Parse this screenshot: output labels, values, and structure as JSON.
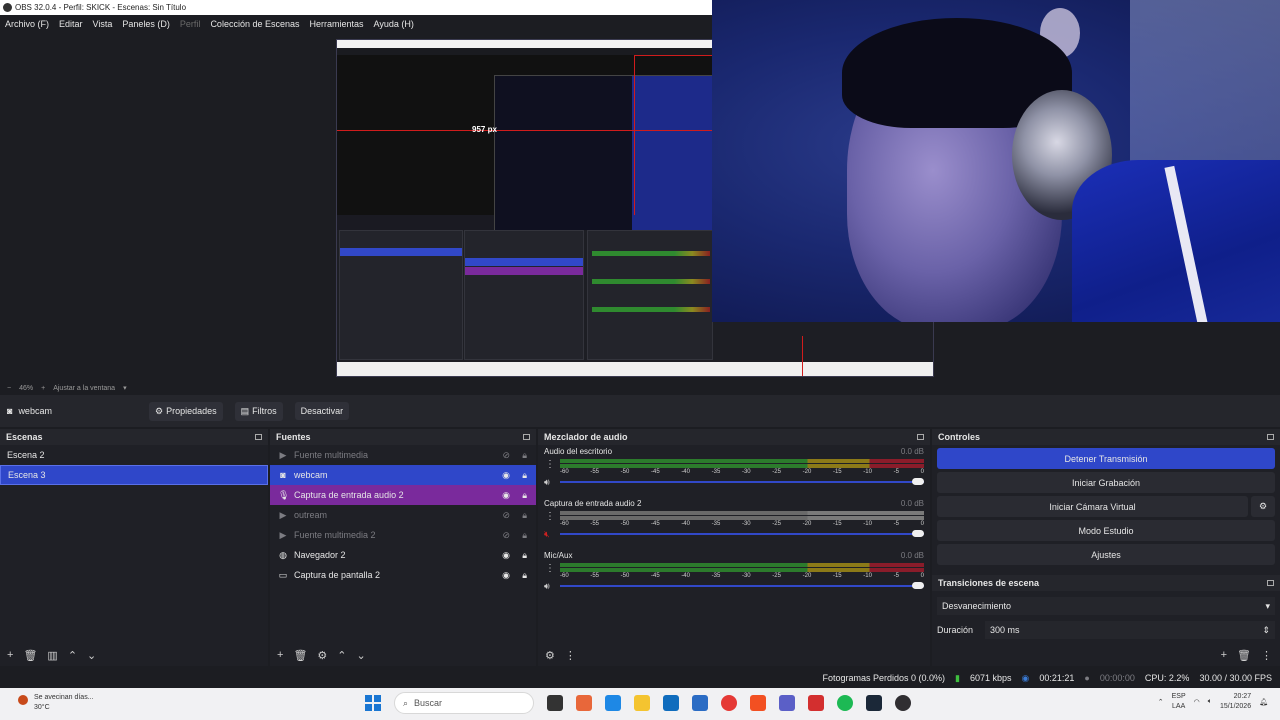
{
  "window": {
    "title": "OBS 32.0.4 - Perfil: SKICK - Escenas: Sin Título"
  },
  "menu": [
    {
      "label": "Archivo (F)",
      "enabled": true
    },
    {
      "label": "Editar",
      "enabled": true
    },
    {
      "label": "Vista",
      "enabled": true
    },
    {
      "label": "Paneles (D)",
      "enabled": true
    },
    {
      "label": "Perfil",
      "enabled": false
    },
    {
      "label": "Colección de Escenas",
      "enabled": true
    },
    {
      "label": "Herramientas",
      "enabled": true
    },
    {
      "label": "Ayuda (H)",
      "enabled": true
    }
  ],
  "preview": {
    "measure_label": "957 px"
  },
  "zoom": {
    "minus": "−",
    "level": "46%",
    "plus": "+",
    "fit_label": "Ajustar a la ventana"
  },
  "context": {
    "source_name": "webcam",
    "properties_label": "Propiedades",
    "filters_label": "Filtros",
    "deactivate_label": "Desactivar"
  },
  "scenes": {
    "title": "Escenas",
    "items": [
      "Escena 2",
      "Escena 3"
    ],
    "selected": 1
  },
  "sources": {
    "title": "Fuentes",
    "items": [
      {
        "name": "Fuente multimedia",
        "icon": "play-icon",
        "visible": false,
        "state": "dim"
      },
      {
        "name": "webcam",
        "icon": "camera-icon",
        "visible": true,
        "state": "selected"
      },
      {
        "name": "Captura de entrada audio 2",
        "icon": "mic-icon",
        "visible": true,
        "state": "purple"
      },
      {
        "name": "outream",
        "icon": "play-icon",
        "visible": false,
        "state": "dim"
      },
      {
        "name": "Fuente multimedia 2",
        "icon": "play-icon",
        "visible": false,
        "state": "dim"
      },
      {
        "name": "Navegador 2",
        "icon": "globe-icon",
        "visible": true,
        "state": "normal"
      },
      {
        "name": "Captura de pantalla 2",
        "icon": "monitor-icon",
        "visible": true,
        "state": "normal"
      }
    ]
  },
  "mixer": {
    "title": "Mezclador de audio",
    "scale": [
      "-60",
      "-55",
      "-50",
      "-45",
      "-40",
      "-35",
      "-30",
      "-25",
      "-20",
      "-15",
      "-10",
      "-5",
      "0"
    ],
    "channels": [
      {
        "name": "Audio del escritorio",
        "db": "0.0 dB",
        "muted": false
      },
      {
        "name": "Captura de entrada audio 2",
        "db": "0.0 dB",
        "muted": true
      },
      {
        "name": "Mic/Aux",
        "db": "0.0 dB",
        "muted": false
      }
    ]
  },
  "controls": {
    "title": "Controles",
    "stop_stream": "Detener Transmisión",
    "start_recording": "Iniciar Grabación",
    "start_virtual_cam": "Iniciar Cámara Virtual",
    "studio_mode": "Modo Estudio",
    "settings": "Ajustes"
  },
  "transitions": {
    "title": "Transiciones de escena",
    "selected": "Desvanecimiento",
    "duration_label": "Duración",
    "duration_value": "300 ms"
  },
  "status": {
    "dropped_frames": "Fotogramas Perdidos 0 (0.0%)",
    "bitrate": "6071 kbps",
    "stream_time": "00:21:21",
    "record_time": "00:00:00",
    "cpu": "CPU: 2.2%",
    "fps": "30.00 / 30.00 FPS"
  },
  "taskbar": {
    "weather_text": "Se avecinan días...",
    "temperature": "30°C",
    "search_placeholder": "Buscar",
    "lang_top": "ESP",
    "lang_bottom": "LAA",
    "time": "20:27",
    "date": "15/1/2026"
  },
  "colors": {
    "accent": "#2f47c9",
    "purple": "#7a2a9c",
    "background": "#1c1d22"
  }
}
